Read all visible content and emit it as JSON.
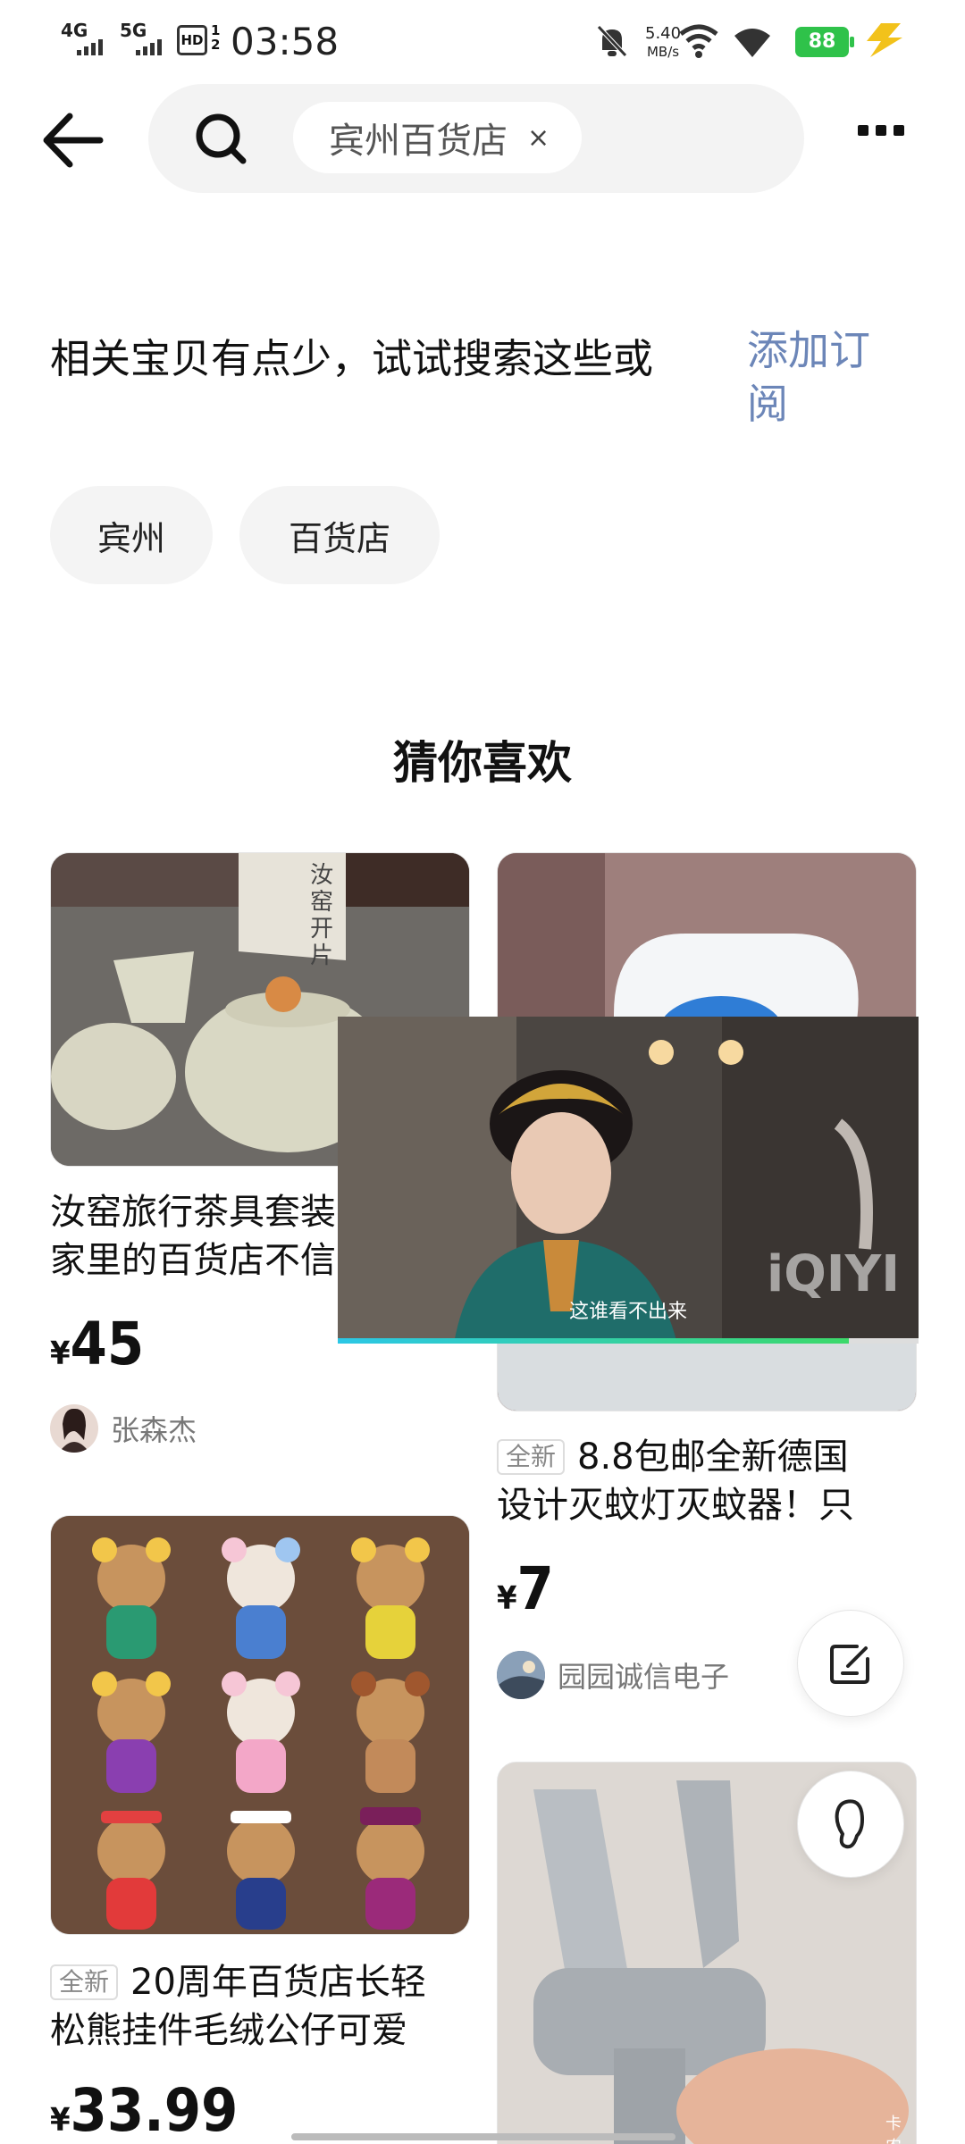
{
  "status_bar": {
    "sig1": "4G",
    "sig2": "5G",
    "hd": "HD",
    "hd_sub": "1 2",
    "time": "03:58",
    "speed_value": "5.40",
    "speed_unit": "MB/s",
    "battery": "88"
  },
  "search": {
    "query": "宾州百货店",
    "clear": "×"
  },
  "message": {
    "text": "相关宝贝有点少，试试搜索这些或",
    "subscribe": "添加订阅"
  },
  "suggestions": [
    "宾州",
    "百货店"
  ],
  "section_title": "猜你喜欢",
  "products": [
    {
      "title_line1": "汝窑旅行茶具套装",
      "title_line2": "家里的百货店不信",
      "currency": "¥",
      "price": "45",
      "seller": "张森杰",
      "image_text": "汝窑开片"
    },
    {
      "tag": "全新",
      "title_line1": "8.8包邮全新德国",
      "title_line2": "设计灭蚊灯灭蚊器！只",
      "currency": "¥",
      "price": "7",
      "seller": "园园诚信电子"
    },
    {
      "tag": "全新",
      "title_line1": "20周年百货店长轻",
      "title_line2": "松熊挂件毛绒公仔可爱",
      "currency": "¥",
      "price": "33.99"
    },
    {
      "image_text": "卡农"
    }
  ],
  "video": {
    "subtitle": "这谁看不出来",
    "watermark": "iQIYI",
    "progress": 0.88
  },
  "icons": {
    "back": "arrow-left-icon",
    "search": "search-icon",
    "more": "more-icon",
    "edit": "edit-icon",
    "footprint": "footprint-icon"
  },
  "colors": {
    "accent_link": "#6c86b8",
    "battery": "#2fc24a",
    "chip_bg": "#f4f4f4"
  }
}
